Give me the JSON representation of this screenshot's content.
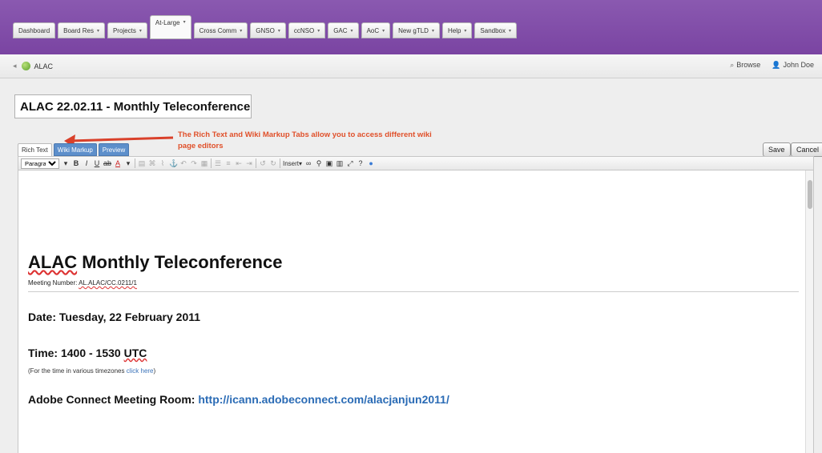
{
  "topnav": {
    "tabs": [
      {
        "label": "Dashboard",
        "caret": false
      },
      {
        "label": "Board Res",
        "caret": true
      },
      {
        "label": "Projects",
        "caret": true
      },
      {
        "label": "At-Large",
        "caret": true,
        "active": true
      },
      {
        "label": "Cross Comm",
        "caret": true
      },
      {
        "label": "GNSO",
        "caret": true
      },
      {
        "label": "ccNSO",
        "caret": true
      },
      {
        "label": "GAC",
        "caret": true
      },
      {
        "label": "AoC",
        "caret": true
      },
      {
        "label": "New gTLD",
        "caret": true
      },
      {
        "label": "Help",
        "caret": true
      },
      {
        "label": "Sandbox",
        "caret": true
      }
    ]
  },
  "breadcrumb": {
    "space": "ALAC",
    "browse": "Browse",
    "user": "John Doe"
  },
  "editor": {
    "title_value": "ALAC 22.02.11 - Monthly Teleconference",
    "annotation": "The Rich Text and Wiki Markup Tabs allow you to access different wiki page editors",
    "tabs": {
      "rich": "Rich Text",
      "wiki": "Wiki Markup",
      "preview": "Preview"
    },
    "save": "Save",
    "cancel": "Cancel",
    "format_select": "Paragraph",
    "insert": "Insert"
  },
  "content": {
    "heading": "ALAC Monthly Teleconference",
    "meeting_label": "Meeting Number: ",
    "meeting_value": "AL.ALAC/CC.0211/1",
    "date": "Date: Tuesday, 22 February 2011",
    "time_prefix": "Time: 1400 - 1530 ",
    "time_utc": "UTC",
    "tz_text": "(For the time in various timezones ",
    "tz_link": "click here",
    "tz_close": ")",
    "adobe_label": "Adobe Connect Meeting Room: ",
    "adobe_link": "http://icann.adobeconnect.com/alacjanjun2011/"
  },
  "colors": {
    "nav_purple": "#7a44a2",
    "annotation": "#e0502a",
    "tab_blue": "#5d8fcb",
    "link": "#2a6bb5"
  }
}
